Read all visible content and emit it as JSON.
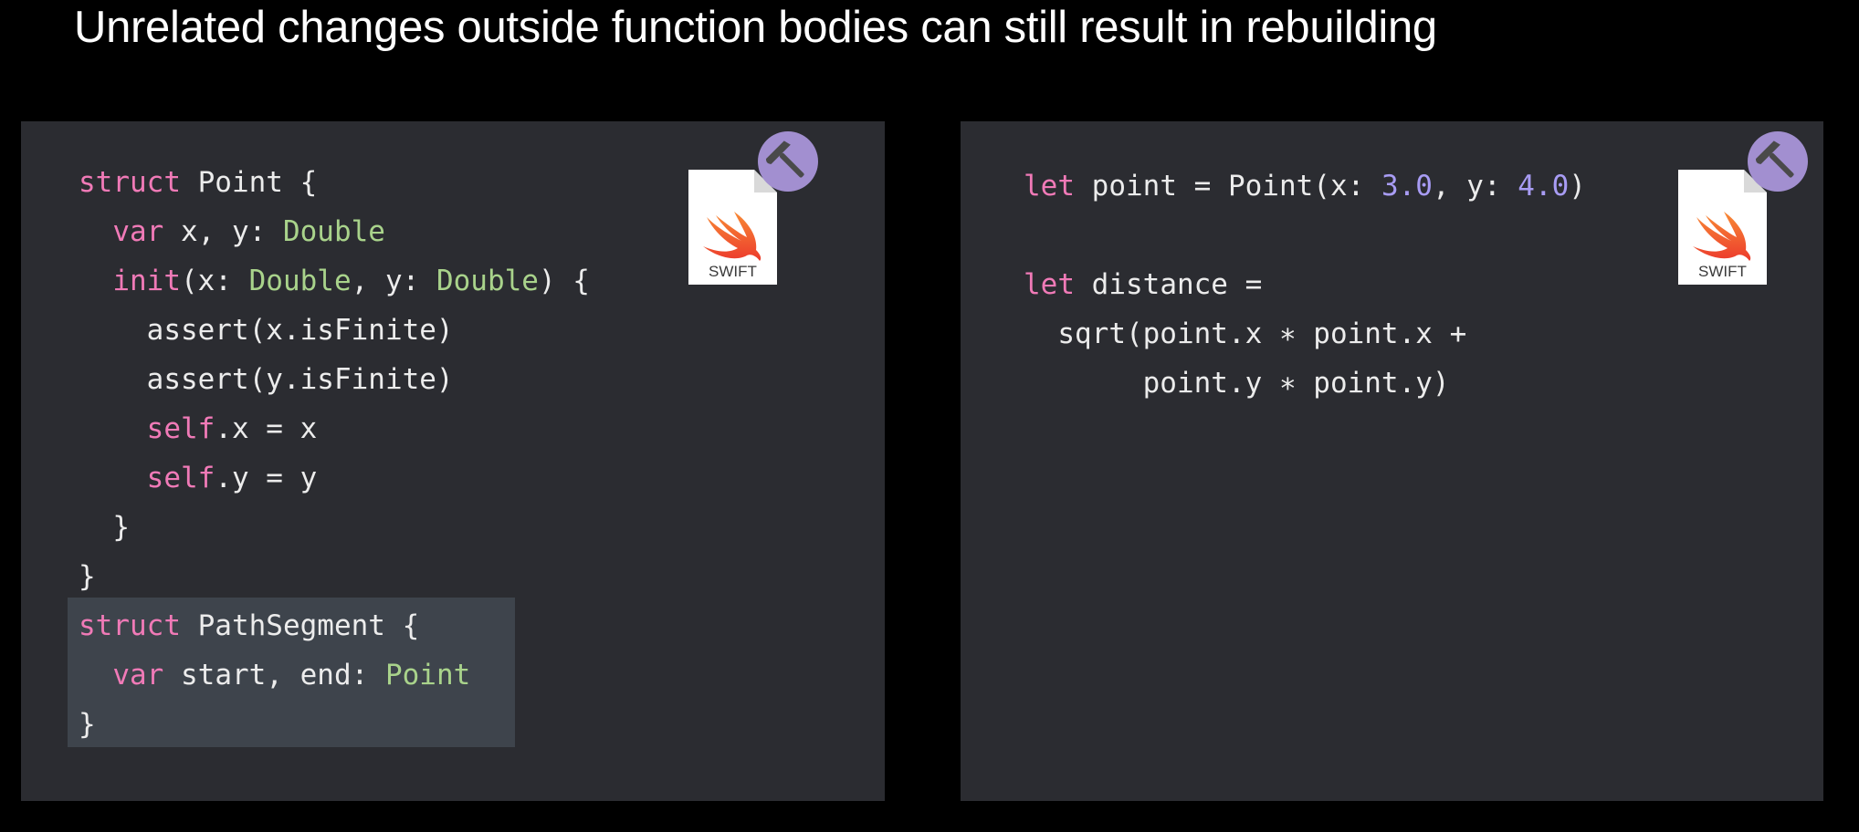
{
  "slide": {
    "title": "Unrelated changes outside function bodies can still result in rebuilding"
  },
  "left_panel": {
    "file_icon": {
      "icon": "swift-file-icon",
      "label": "SWIFT",
      "badge_icon": "hammer-icon"
    },
    "lines": [
      [
        {
          "t": "struct",
          "c": "kw"
        },
        {
          "t": " Point {",
          "c": "plain"
        }
      ],
      [
        {
          "t": "  ",
          "c": "plain"
        },
        {
          "t": "var",
          "c": "kw"
        },
        {
          "t": " x, y: ",
          "c": "plain"
        },
        {
          "t": "Double",
          "c": "ty"
        }
      ],
      [
        {
          "t": "  ",
          "c": "plain"
        },
        {
          "t": "init",
          "c": "kw"
        },
        {
          "t": "(x: ",
          "c": "plain"
        },
        {
          "t": "Double",
          "c": "ty"
        },
        {
          "t": ", y: ",
          "c": "plain"
        },
        {
          "t": "Double",
          "c": "ty"
        },
        {
          "t": ") {",
          "c": "plain"
        }
      ],
      [
        {
          "t": "    assert(x.isFinite)",
          "c": "plain"
        }
      ],
      [
        {
          "t": "    assert(y.isFinite)",
          "c": "plain"
        }
      ],
      [
        {
          "t": "    ",
          "c": "plain"
        },
        {
          "t": "self",
          "c": "kw"
        },
        {
          "t": ".x = x",
          "c": "plain"
        }
      ],
      [
        {
          "t": "    ",
          "c": "plain"
        },
        {
          "t": "self",
          "c": "kw"
        },
        {
          "t": ".y = y",
          "c": "plain"
        }
      ],
      [
        {
          "t": "  }",
          "c": "plain"
        }
      ],
      [
        {
          "t": "}",
          "c": "plain"
        }
      ],
      [
        {
          "t": "struct",
          "c": "kw"
        },
        {
          "t": " PathSegment {",
          "c": "plain"
        }
      ],
      [
        {
          "t": "  ",
          "c": "plain"
        },
        {
          "t": "var",
          "c": "kw"
        },
        {
          "t": " start, end: ",
          "c": "plain"
        },
        {
          "t": "Point",
          "c": "ty"
        }
      ],
      [
        {
          "t": "}",
          "c": "plain"
        }
      ]
    ]
  },
  "right_panel": {
    "file_icon": {
      "icon": "swift-file-icon",
      "label": "SWIFT",
      "badge_icon": "hammer-icon"
    },
    "lines": [
      [
        {
          "t": "let",
          "c": "kw"
        },
        {
          "t": " point = Point(x: ",
          "c": "plain"
        },
        {
          "t": "3.0",
          "c": "num"
        },
        {
          "t": ", y: ",
          "c": "plain"
        },
        {
          "t": "4.0",
          "c": "num"
        },
        {
          "t": ")",
          "c": "plain"
        }
      ],
      [
        {
          "t": "",
          "c": "plain"
        }
      ],
      [
        {
          "t": "let",
          "c": "kw"
        },
        {
          "t": " distance =",
          "c": "plain"
        }
      ],
      [
        {
          "t": "  sqrt(point.x ∗ point.x +",
          "c": "plain"
        }
      ],
      [
        {
          "t": "       point.y ∗ point.y)",
          "c": "plain"
        }
      ]
    ]
  },
  "colors": {
    "background": "#000000",
    "panel": "#2b2c31",
    "highlight": "#3e444c",
    "keyword": "#f07ab7",
    "type": "#a9d38b",
    "number": "#a89cf4",
    "text": "#ececec",
    "badge": "#a28fd0"
  }
}
